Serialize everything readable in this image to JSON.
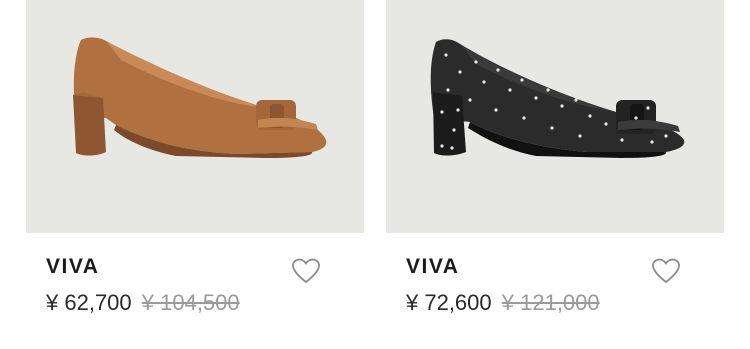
{
  "colors": {
    "image_bg": "#e7e7e4",
    "price": "#2a2a2a",
    "old_price": "#9a9a9a"
  },
  "products": [
    {
      "name": "VIVA",
      "price": "¥ 62,700",
      "original_price": "¥ 104,500",
      "image": "tan leather block-heel pump with bow",
      "favorite_icon": "heart-outline-icon"
    },
    {
      "name": "VIVA",
      "price": "¥ 72,600",
      "original_price": "¥ 121,000",
      "image": "black studded leather block-heel pump with bow",
      "favorite_icon": "heart-outline-icon"
    }
  ]
}
